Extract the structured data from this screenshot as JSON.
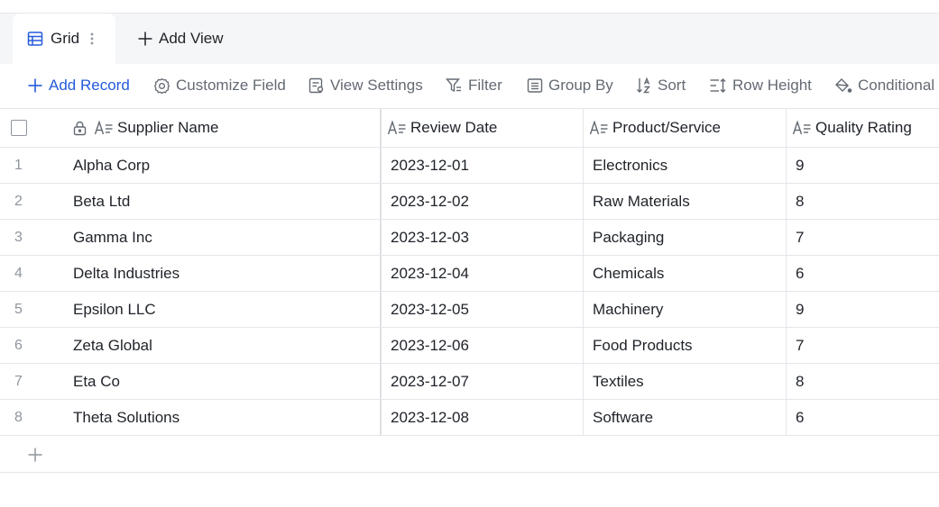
{
  "views": {
    "active_tab": {
      "label": "Grid",
      "icon": "grid-table-icon"
    },
    "add_view_label": "Add View"
  },
  "toolbar": {
    "add_record": "Add Record",
    "customize_field": "Customize Field",
    "view_settings": "View Settings",
    "filter": "Filter",
    "group_by": "Group By",
    "sort": "Sort",
    "row_height": "Row Height",
    "conditional": "Conditional"
  },
  "columns": [
    "Supplier Name",
    "Review Date",
    "Product/Service",
    "Quality Rating"
  ],
  "rows": [
    {
      "index": "1",
      "supplier": "Alpha Corp",
      "date": "2023-12-01",
      "product": "Electronics",
      "rating": "9"
    },
    {
      "index": "2",
      "supplier": "Beta Ltd",
      "date": "2023-12-02",
      "product": "Raw Materials",
      "rating": "8"
    },
    {
      "index": "3",
      "supplier": "Gamma Inc",
      "date": "2023-12-03",
      "product": "Packaging",
      "rating": "7"
    },
    {
      "index": "4",
      "supplier": "Delta Industries",
      "date": "2023-12-04",
      "product": "Chemicals",
      "rating": "6"
    },
    {
      "index": "5",
      "supplier": "Epsilon LLC",
      "date": "2023-12-05",
      "product": "Machinery",
      "rating": "9"
    },
    {
      "index": "6",
      "supplier": "Zeta Global",
      "date": "2023-12-06",
      "product": "Food Products",
      "rating": "7"
    },
    {
      "index": "7",
      "supplier": "Eta Co",
      "date": "2023-12-07",
      "product": "Textiles",
      "rating": "8"
    },
    {
      "index": "8",
      "supplier": "Theta Solutions",
      "date": "2023-12-08",
      "product": "Software",
      "rating": "6"
    }
  ],
  "colors": {
    "accent": "#245bdb",
    "muted": "#646a73",
    "border": "#e4e6ea",
    "tabbar_bg": "#f5f6f7"
  }
}
